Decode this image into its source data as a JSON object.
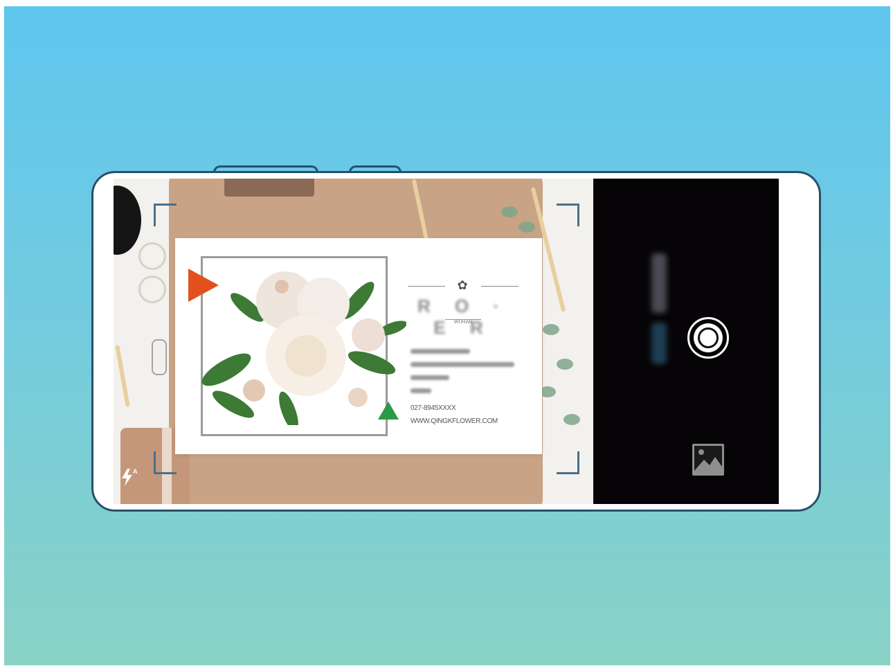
{
  "screen": {
    "description_colors": {
      "background_top": "#5fc6ee",
      "background_bottom": "#89d2c6",
      "phone_outline": "#27506a",
      "panel": "#060406"
    }
  },
  "viewfinder": {
    "card": {
      "logo_name": "R O · E R",
      "logo_sub": "WUHAN",
      "phone": "027-8945XXXX",
      "website": "WWW.QINGKFLOWER.COM"
    },
    "flash_icon": "flash-auto-icon"
  },
  "controls": {
    "shutter_icon": "shutter-icon",
    "gallery_icon": "gallery-icon"
  }
}
